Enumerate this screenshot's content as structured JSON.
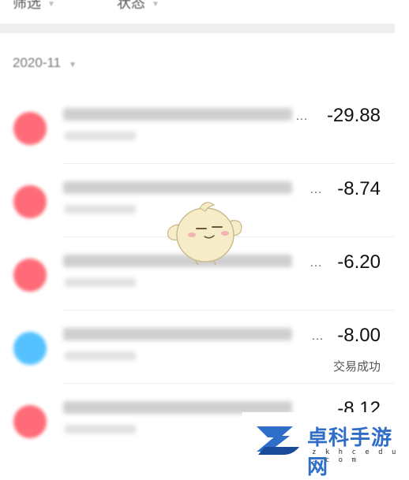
{
  "filters": {
    "filter_label": "筛选",
    "status_label": "状态"
  },
  "month": {
    "label": "2020-11"
  },
  "transactions": [
    {
      "amount": "-29.88",
      "dot_color": "#ff6b78",
      "status": ""
    },
    {
      "amount": "-8.74",
      "dot_color": "#ff6b78",
      "status": ""
    },
    {
      "amount": "-6.20",
      "dot_color": "#ff6b78",
      "status": ""
    },
    {
      "amount": "-8.00",
      "dot_color": "#55c2ff",
      "status": "交易成功"
    },
    {
      "amount": "-8.12",
      "dot_color": "#ff6b78",
      "status": ""
    }
  ],
  "watermark": {
    "title": "卓科手游网",
    "url": "z k h c e d u . c o m"
  },
  "icons": {
    "mascot": "chick-mascot-icon",
    "logo": "z-logo-icon",
    "caret": "chevron-down-icon"
  }
}
